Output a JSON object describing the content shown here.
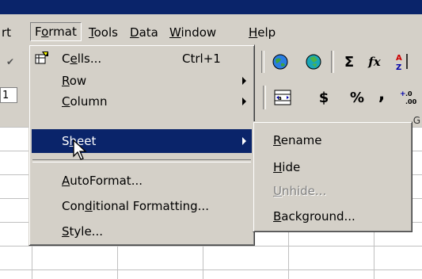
{
  "menubar": {
    "items": [
      {
        "label": "rt",
        "hotkey": ""
      },
      {
        "label": "Format",
        "hotkey": "o"
      },
      {
        "label": "Tools",
        "hotkey": "T"
      },
      {
        "label": "Data",
        "hotkey": "D"
      },
      {
        "label": "Window",
        "hotkey": "W"
      },
      {
        "label": "Help",
        "hotkey": "H"
      }
    ]
  },
  "toolbar": {
    "namebox": "1",
    "sigma": "Σ",
    "fx": "fx",
    "currency": "$",
    "percent": "%",
    "comma": ","
  },
  "format_menu": {
    "items": [
      {
        "pre": "C",
        "u": "e",
        "post": "lls...",
        "accel": "Ctrl+1",
        "submenu": false
      },
      {
        "pre": "",
        "u": "R",
        "post": "ow",
        "accel": "",
        "submenu": true
      },
      {
        "pre": "",
        "u": "C",
        "post": "olumn",
        "accel": "",
        "submenu": true
      },
      {
        "pre": "S",
        "u": "h",
        "post": "eet",
        "accel": "",
        "submenu": true,
        "highlighted": true
      },
      {
        "pre": "",
        "u": "A",
        "post": "utoFormat...",
        "accel": "",
        "submenu": false
      },
      {
        "pre": "Con",
        "u": "d",
        "post": "itional Formatting...",
        "accel": "",
        "submenu": false
      },
      {
        "pre": "",
        "u": "S",
        "post": "tyle...",
        "accel": "",
        "submenu": false
      }
    ]
  },
  "sheet_submenu": {
    "items": [
      {
        "pre": "",
        "u": "R",
        "post": "ename",
        "disabled": false
      },
      {
        "pre": "",
        "u": "H",
        "post": "ide",
        "disabled": false
      },
      {
        "pre": "",
        "u": "U",
        "post": "nhide...",
        "disabled": true
      },
      {
        "pre": "",
        "u": "B",
        "post": "ackground...",
        "disabled": false
      }
    ]
  },
  "colors": {
    "highlight": "#0a246a",
    "face": "#d4d0c8"
  }
}
